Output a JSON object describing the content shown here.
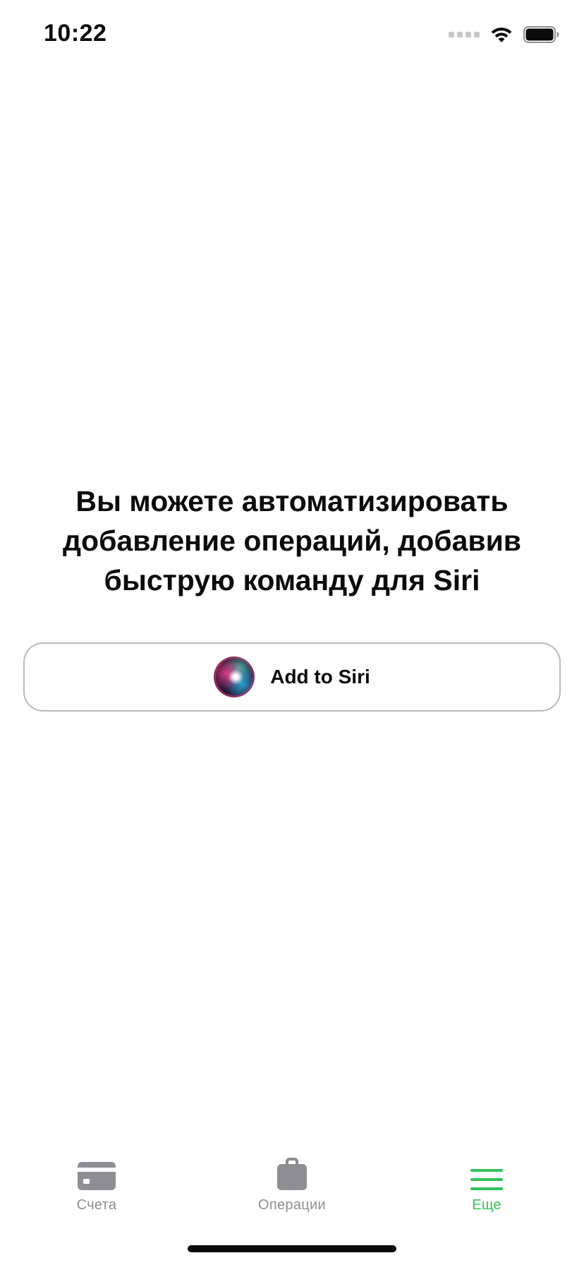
{
  "status_bar": {
    "time": "10:22",
    "icons": [
      "cellular-signal-icon",
      "wifi-icon",
      "battery-icon"
    ]
  },
  "main": {
    "headline": "Вы можете автоматизировать добавление операций, добавив быструю команду для Siri",
    "siri_button": {
      "label": "Add to Siri",
      "icon": "siri-orb-icon"
    }
  },
  "tab_bar": {
    "active_color": "#35c35a",
    "inactive_color": "#8e8e93",
    "tabs": [
      {
        "label": "Счета",
        "icon": "card-icon",
        "active": false
      },
      {
        "label": "Операции",
        "icon": "bag-icon",
        "active": false
      },
      {
        "label": "Еще",
        "icon": "menu-icon",
        "active": true
      }
    ]
  }
}
